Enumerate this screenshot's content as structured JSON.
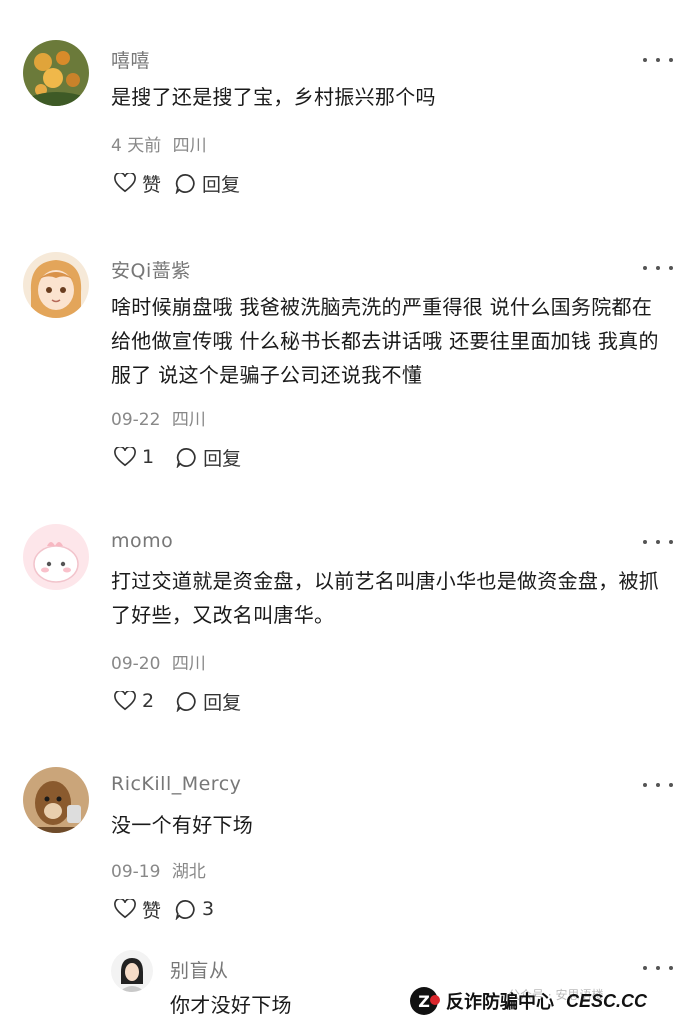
{
  "comments": [
    {
      "username": "嘻嘻",
      "text": "是搜了还是搜了宝，乡村振兴那个吗",
      "time": "4 天前",
      "location": "四川",
      "like_label": "赞",
      "reply_label": "回复"
    },
    {
      "username": "安Qi蔷紫",
      "text": "啥时候崩盘哦 我爸被洗脑壳洗的严重得很 说什么国务院都在给他做宣传哦 什么秘书长都去讲话哦 还要往里面加钱 我真的服了 说这个是骗子公司还说我不懂",
      "time": "09-22",
      "location": "四川",
      "like_label": "1",
      "reply_label": "回复"
    },
    {
      "username": "momo",
      "text": "打过交道就是资金盘，以前艺名叫唐小华也是做资金盘，被抓了好些，又改名叫唐华。",
      "time": "09-20",
      "location": "四川",
      "like_label": "2",
      "reply_label": "回复"
    },
    {
      "username": "RicKill_Mercy",
      "text": "没一个有好下场",
      "time": "09-19",
      "location": "湖北",
      "like_label": "赞",
      "reply_label": "3"
    }
  ],
  "reply": {
    "username": "别盲从",
    "text": "你才没好下场"
  },
  "watermark": {
    "logo_char": "Z",
    "label": "反诈防骗中心",
    "site": "CESC.CC",
    "faint": "公众号 · 安思语楼"
  },
  "colors": {
    "username": "#777777",
    "meta": "#888888",
    "text": "#1a1a1a"
  }
}
